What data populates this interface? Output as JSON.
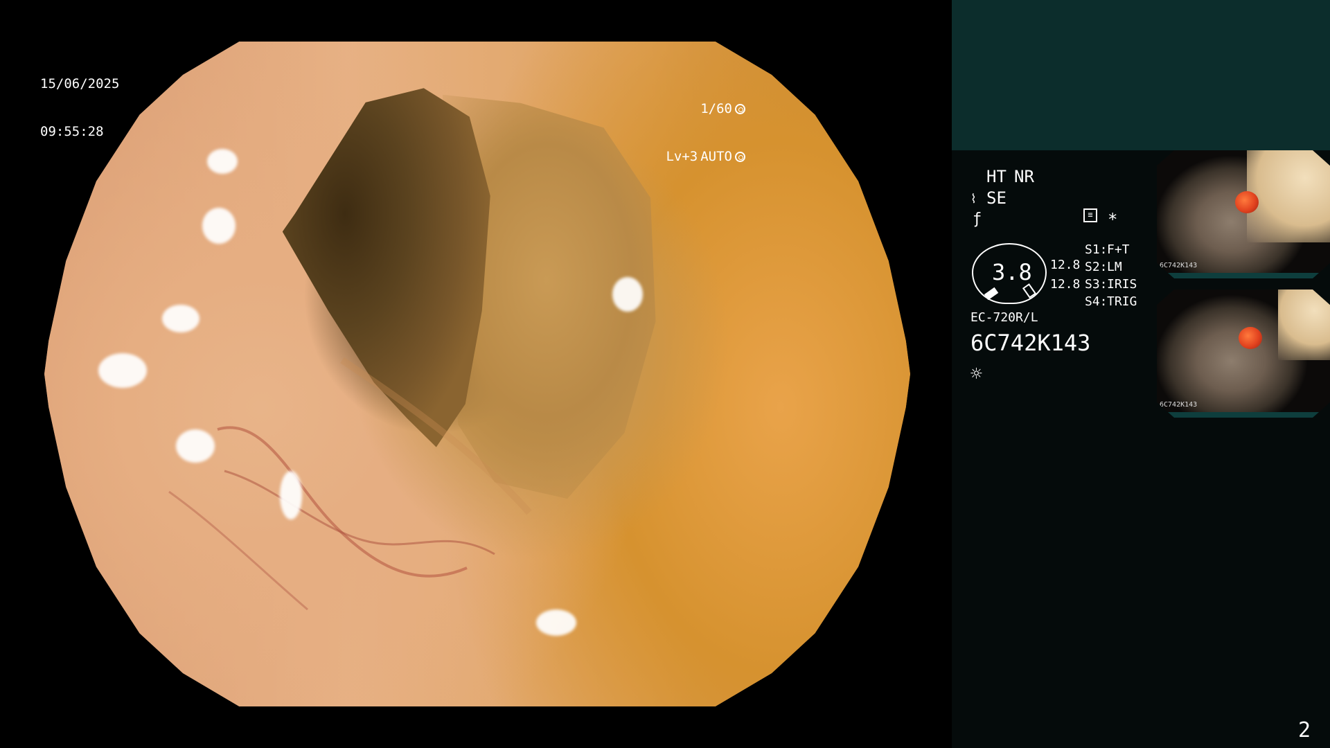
{
  "overlay": {
    "date": "15/06/2025",
    "time": "09:55:28",
    "shutter": "1/60",
    "level": "Lv+3",
    "exposure_mode": "AUTO"
  },
  "panel": {
    "mode_ht": "HT",
    "mode_nr": "NR",
    "mode_se": "SE",
    "gauge_value": "3.8",
    "value_a": "12.8",
    "value_b": "12.8",
    "s1_label": "S1:",
    "s1_value": "F+T",
    "s2_label": "S2:",
    "s2_value": "LM",
    "s3_label": "S3:",
    "s3_value": "IRIS",
    "s4_label": "S4:",
    "s4_value": "TRIG",
    "scope_model": "EC-720R/L",
    "serial": "6C742K143",
    "asterisk": "*"
  },
  "thumbnails": [
    {
      "label": "6C742K143"
    },
    {
      "label": "6C742K143"
    }
  ],
  "page_number": "2",
  "colors": {
    "panel_top": "#0c2d2c",
    "panel_bg": "#050b0b",
    "accent_orange": "#ffb62e",
    "text": "#ffffff"
  }
}
